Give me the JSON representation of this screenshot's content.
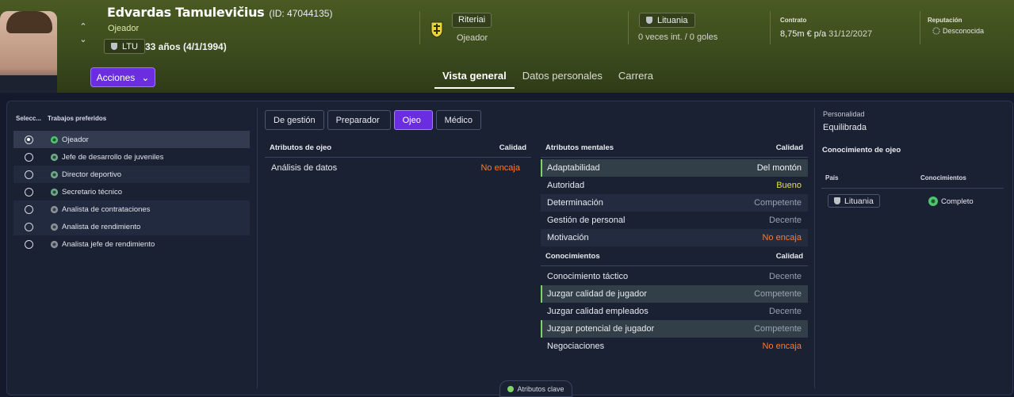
{
  "header": {
    "name": "Edvardas Tamulevičius",
    "id_text": "(ID: 47044135)",
    "role": "Ojeador",
    "nationality_code": "LTU",
    "age_text": "33 años (4/1/1994)",
    "actions_label": "Acciones",
    "club_name": "Riteriai",
    "club_role": "Ojeador",
    "nation_name": "Lituania",
    "intl_text": "0 veces int. / 0 goles",
    "contract_label": "Contrato",
    "contract_value": "8,75m € p/a",
    "contract_date": "31/12/2027",
    "reputation_label": "Reputación",
    "reputation_value": "Desconocida"
  },
  "main_tabs": [
    {
      "label": "Vista general",
      "active": true
    },
    {
      "label": "Datos personales",
      "active": false
    },
    {
      "label": "Carrera",
      "active": false
    }
  ],
  "jobs": {
    "header_select": "Selecc...",
    "header_title": "Trabajos preferidos",
    "items": [
      {
        "label": "Ojeador",
        "selected": true
      },
      {
        "label": "Jefe de desarrollo de juveniles",
        "selected": false
      },
      {
        "label": "Director deportivo",
        "selected": false
      },
      {
        "label": "Secretario técnico",
        "selected": false
      },
      {
        "label": "Analista de contrataciones",
        "selected": false
      },
      {
        "label": "Analista de rendimiento",
        "selected": false
      },
      {
        "label": "Analista jefe de rendimiento",
        "selected": false
      }
    ]
  },
  "sub_tabs": [
    {
      "label": "De gestión",
      "active": false
    },
    {
      "label": "Preparador",
      "active": false
    },
    {
      "label": "Ojeo",
      "active": true
    },
    {
      "label": "Médico",
      "active": false
    }
  ],
  "ojeo_attrs": {
    "title": "Atributos de ojeo",
    "quality_label": "Calidad",
    "rows": [
      {
        "name": "Análisis de datos",
        "value": "No encaja",
        "tone": "orange"
      }
    ]
  },
  "mental_attrs": {
    "title": "Atributos mentales",
    "quality_label": "Calidad",
    "rows": [
      {
        "name": "Adaptabilidad",
        "value": "Del montón",
        "tone": "white",
        "key": true
      },
      {
        "name": "Autoridad",
        "value": "Bueno",
        "tone": "yellow",
        "key": false
      },
      {
        "name": "Determinación",
        "value": "Competente",
        "tone": "gray",
        "key": false
      },
      {
        "name": "Gestión de personal",
        "value": "Decente",
        "tone": "gray",
        "key": false
      },
      {
        "name": "Motivación",
        "value": "No encaja",
        "tone": "orange",
        "key": false
      }
    ]
  },
  "knowledge_attrs": {
    "title": "Conocimientos",
    "quality_label": "Calidad",
    "rows": [
      {
        "name": "Conocimiento táctico",
        "value": "Decente",
        "tone": "gray",
        "key": false
      },
      {
        "name": "Juzgar calidad de jugador",
        "value": "Competente",
        "tone": "gray",
        "key": true
      },
      {
        "name": "Juzgar calidad empleados",
        "value": "Decente",
        "tone": "gray",
        "key": false
      },
      {
        "name": "Juzgar potencial de jugador",
        "value": "Competente",
        "tone": "gray",
        "key": true
      },
      {
        "name": "Negociaciones",
        "value": "No encaja",
        "tone": "orange",
        "key": false
      }
    ]
  },
  "personality": {
    "label": "Personalidad",
    "value": "Equilibrada"
  },
  "scout_knowledge": {
    "title": "Conocimiento de ojeo",
    "col_country": "País",
    "col_knowledge": "Conocimientos",
    "rows": [
      {
        "country": "Lituania",
        "level": "Completo"
      }
    ]
  },
  "footer": {
    "key_attrs_label": "Atributos clave"
  },
  "colors": {
    "accent_purple": "#6a2ee0",
    "key_green": "#7fd36a",
    "orange": "#ff7a2a",
    "yellow": "#e2e04a"
  }
}
